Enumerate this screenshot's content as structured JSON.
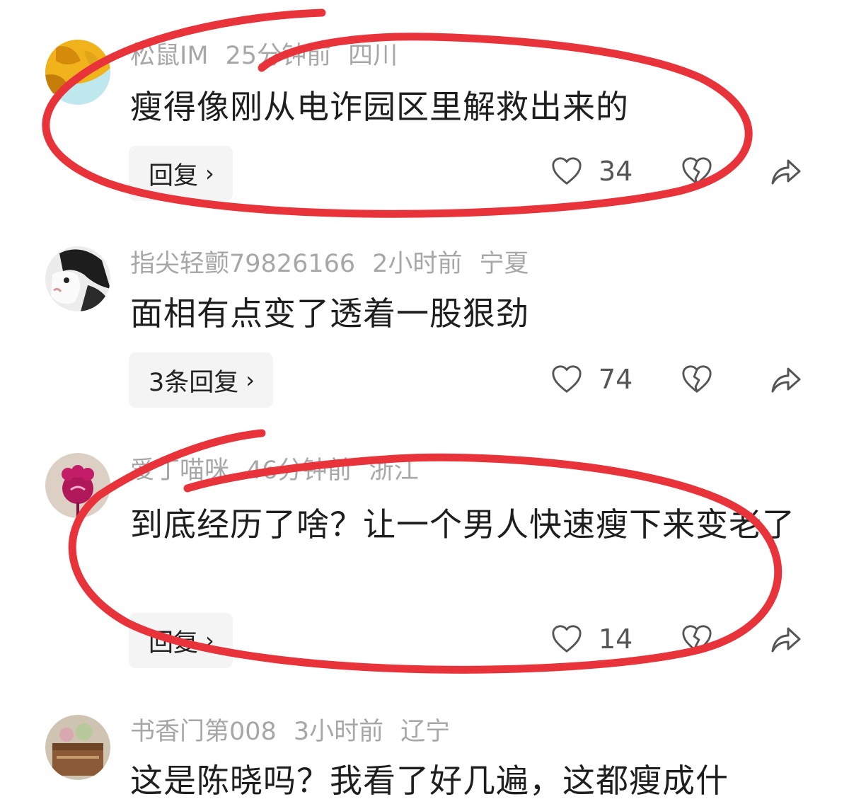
{
  "comments": [
    {
      "username": "松鼠IM",
      "time": "25分钟前",
      "location": "四川",
      "text": "瘦得像刚从电诈园区里解救出来的",
      "reply_label": "回复",
      "likes": "34"
    },
    {
      "username": "指尖轻颤79826166",
      "time": "2小时前",
      "location": "宁夏",
      "text": "面相有点变了透着一股狠劲",
      "reply_label": "3条回复",
      "likes": "74"
    },
    {
      "username": "爱丁喵咪",
      "time": "46分钟前",
      "location": "浙江",
      "text": "到底经历了啥？让一个男人快速瘦下来变老了",
      "reply_label": "回复",
      "likes": "14"
    },
    {
      "username": "书香门第008",
      "time": "3小时前",
      "location": "辽宁",
      "text": "这是陈晓吗？我看了好几遍，这都瘦成什"
    }
  ],
  "icons": {
    "like": "heart-outline-icon",
    "dislike": "broken-heart-icon",
    "share": "share-arrow-icon",
    "chevron": "chevron-right-icon"
  },
  "colors": {
    "annotation": "#e8333a",
    "meta_text": "#a7a7a7",
    "body_text": "#1e1e1e",
    "reply_bg": "#f4f4f4"
  }
}
